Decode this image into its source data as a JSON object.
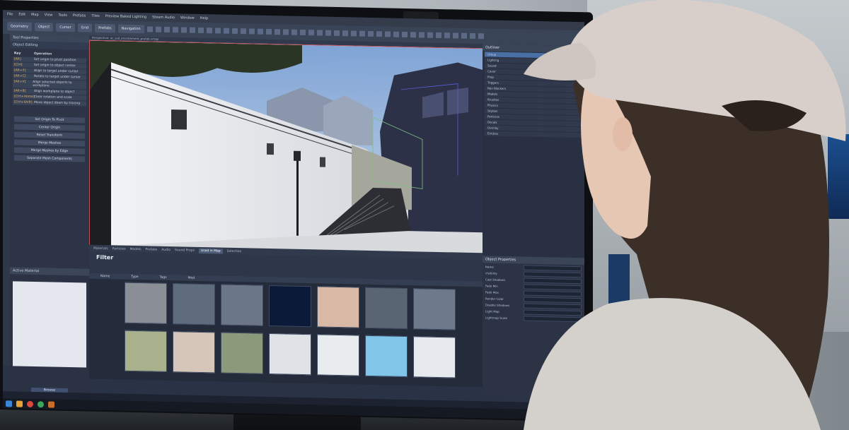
{
  "scene": {
    "description_free": true
  },
  "app": {
    "menu": [
      "File",
      "Edit",
      "Map",
      "View",
      "Tools",
      "Prefabs",
      "Tiles",
      "Preview Baked Lighting",
      "Steam Audio",
      "Window",
      "Help"
    ],
    "toolbar_buttons": [
      "Geometry",
      "Object",
      "Cursor",
      "Grid",
      "Prefabs",
      "Navigation"
    ],
    "tool_panel_title": "Tool Properties",
    "tool_panel_subtitle": "Object Editing",
    "kb_headers": [
      "Key",
      "Operation"
    ],
    "kb_rows": [
      [
        "[Alt]",
        "Set origin to pivot position"
      ],
      [
        "[Ctrl]",
        "Set origin to object center"
      ],
      [
        "[Alt+X]",
        "Align to target under cursor"
      ],
      [
        "[Alt+C]",
        "Rotate to target under cursor"
      ],
      [
        "[Alt+V]",
        "Align selected objects to workplane"
      ],
      [
        "[Alt+B]",
        "Align workplane to object"
      ],
      [
        "[Ctrl+Home]",
        "Clear rotation and scale"
      ],
      [
        "[Ctrl+Shift]",
        "Move object down by tracing"
      ]
    ],
    "operations": [
      "Set Origin To Pivot",
      "Center Origin",
      "Reset Transform",
      "Merge Meshes",
      "Merge Meshes by Edge",
      "Separate Mesh Components"
    ],
    "viewport_tab": "Perspective: ac_ssd_environment_prefab.vmap",
    "asset_tabs": [
      "Materials",
      "Particles",
      "Models",
      "Prefabs",
      "Audio",
      "Sound Props",
      "Used in Map",
      "Selection"
    ],
    "filter_label": "Filter",
    "asset_columns": [
      "Name",
      "Type",
      "Tags",
      "Mod"
    ],
    "assets": [
      {
        "name": "",
        "color": "#8a8f96"
      },
      {
        "name": "",
        "color": "#5f6c7e"
      },
      {
        "name": "",
        "color": "#6b7686"
      },
      {
        "name": "",
        "color": "#0c1a3a"
      },
      {
        "name": "",
        "color": "#d9b8a6"
      },
      {
        "name": "",
        "color": "#5a6574"
      },
      {
        "name": "",
        "color": "#6e7a8a"
      },
      {
        "name": "",
        "color": "#a8b08c"
      },
      {
        "name": "",
        "color": "#d6c6b9"
      },
      {
        "name": "",
        "color": "#8a9a7a"
      },
      {
        "name": "",
        "color": "#dfe3e8"
      },
      {
        "name": "",
        "color": "#e9ecef"
      },
      {
        "name": "",
        "color": "#7fc6e8"
      },
      {
        "name": "",
        "color": "#e6eaee"
      }
    ],
    "material_panel_title": "Active Material",
    "browse_label": "Browse",
    "outliner_title": "Outliner",
    "outliner_items": [
      "Group",
      "Lighting",
      "Sound",
      "Cover",
      "Prop",
      "Triggers",
      "Nav Blockers",
      "Models",
      "Brushes",
      "Physics",
      "Skybox",
      "Particles",
      "Decals",
      "Overlay",
      "Entities"
    ],
    "props_title": "Object Properties",
    "props_rows": [
      "Name",
      "Visibility",
      "Cast Shadows",
      "Fade Min",
      "Fade Max",
      "Render Color",
      "Disable Shadows",
      "Light Map",
      "Lightmap Scale"
    ],
    "colors": {
      "accent": "#c0505a",
      "panel": "#2c3445",
      "selection": "#4a6fa5"
    }
  }
}
